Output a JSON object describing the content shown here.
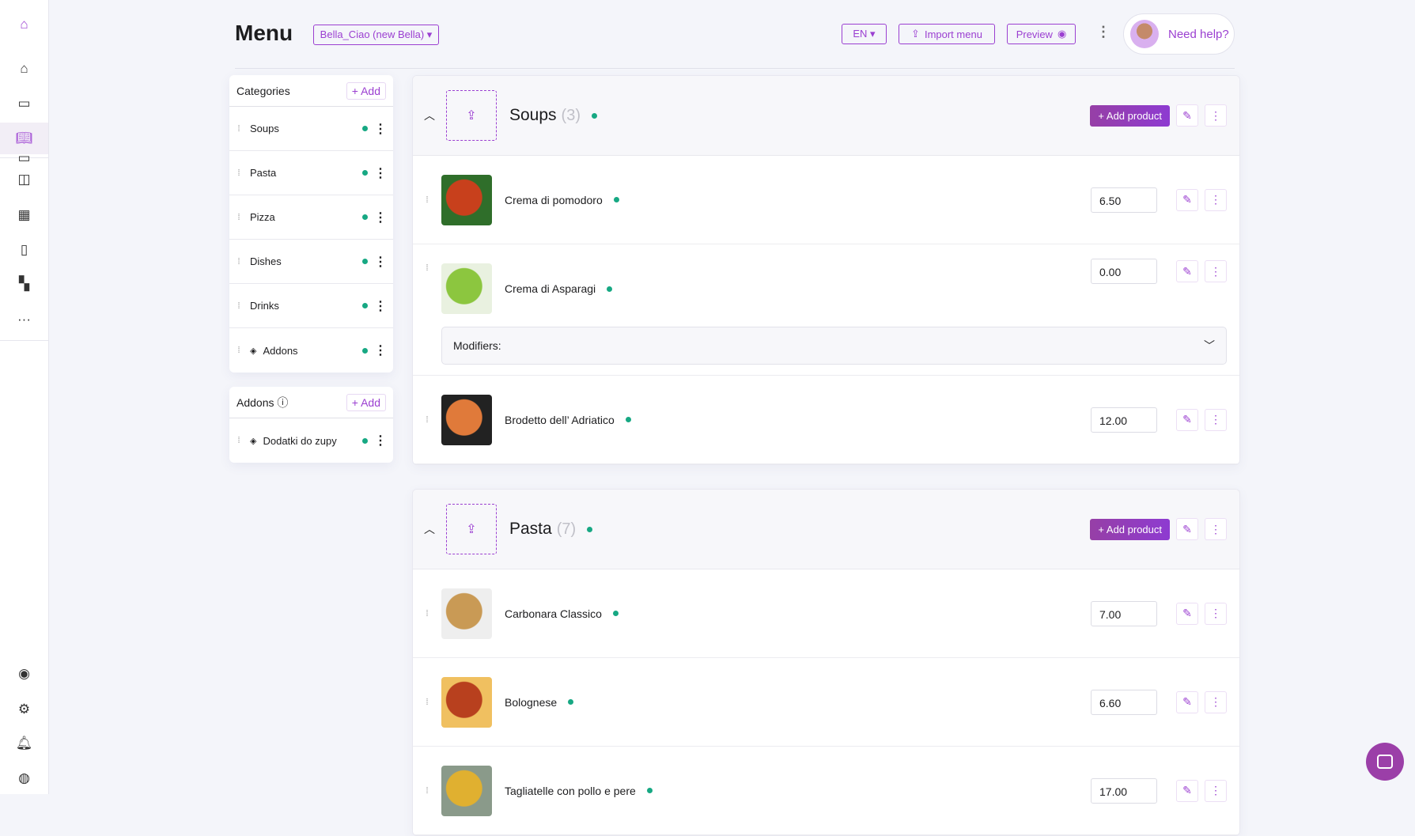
{
  "header": {
    "title": "Menu",
    "restaurant_select": "Bella_Ciao (new Bella) ▾",
    "language": "EN ▾",
    "import_label": "Import menu",
    "preview_label": "Preview",
    "help_label": "Need help?"
  },
  "sidebar": {
    "top": [
      "logo",
      "home-icon",
      "inbox-icon",
      "menu-book-icon",
      "monitor-icon",
      "bag-icon",
      "calendar-icon",
      "phone-icon",
      "qr-code-icon",
      "more-icon"
    ],
    "bottom": [
      "eye-icon",
      "gear-icon",
      "bell-icon",
      "restaurant-avatar"
    ],
    "active": "menu-book-icon"
  },
  "categories": {
    "title": "Categories",
    "add_label": "+ Add",
    "items": [
      {
        "name": "Soups",
        "hidden": false
      },
      {
        "name": "Pasta",
        "hidden": false
      },
      {
        "name": "Pizza",
        "hidden": false
      },
      {
        "name": "Dishes",
        "hidden": false
      },
      {
        "name": "Drinks",
        "hidden": false
      },
      {
        "name": "Addons",
        "hidden": true
      }
    ]
  },
  "addons": {
    "title": "Addons",
    "add_label": "+ Add",
    "items": [
      {
        "name": "Dodatki do zupy",
        "hidden": true
      }
    ]
  },
  "add_product_label": "+  Add product",
  "modifiers_label": "Modifiers:",
  "sections": [
    {
      "name": "Soups",
      "count": "(3)",
      "products": [
        {
          "name": "Crema di pomodoro",
          "price": "6.50",
          "thumb": [
            "#c8401c",
            "#2f6e2a"
          ]
        },
        {
          "name": "Crema di Asparagi",
          "price": "0.00",
          "thumb": [
            "#8cc63f",
            "#e9f1e0"
          ],
          "modifiers": true
        },
        {
          "name": "Brodetto dell’ Adriatico",
          "price": "12.00",
          "thumb": [
            "#e07a3a",
            "#222"
          ]
        }
      ]
    },
    {
      "name": "Pasta",
      "count": "(7)",
      "products": [
        {
          "name": "Carbonara Classico",
          "price": "7.00",
          "thumb": [
            "#c99a55",
            "#eee"
          ]
        },
        {
          "name": "Bolognese",
          "price": "6.60",
          "thumb": [
            "#b8401e",
            "#f0c060"
          ]
        },
        {
          "name": "Tagliatelle con pollo e pere",
          "price": "17.00",
          "thumb": [
            "#e0b030",
            "#8a9a8a"
          ]
        }
      ]
    }
  ],
  "colors": {
    "accent": "#9b3fd1",
    "active_dot": "#17a883"
  }
}
